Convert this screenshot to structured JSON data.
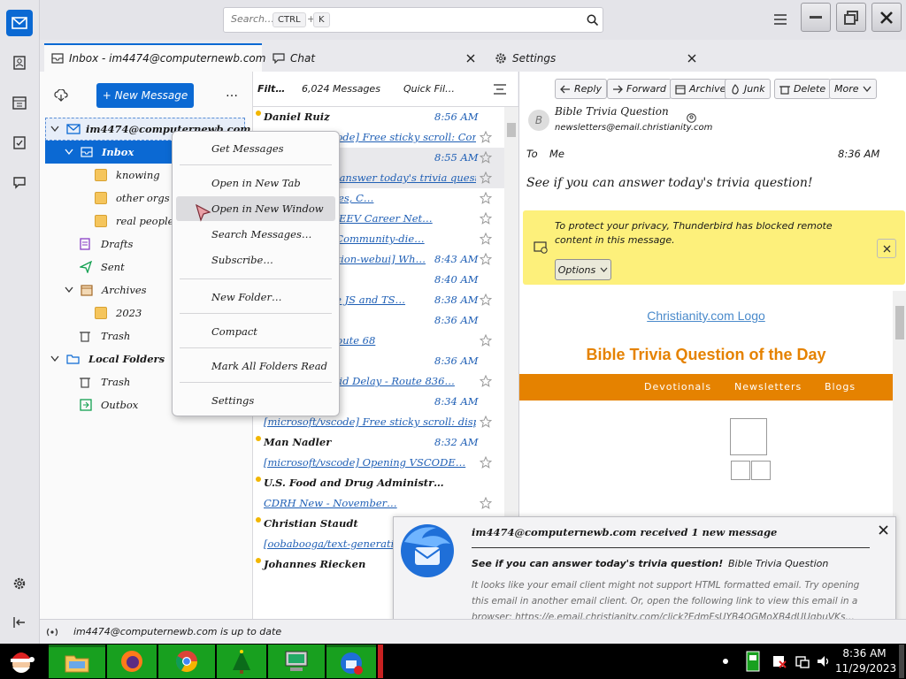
{
  "search": {
    "placeholder": "Search…",
    "key1": "CTRL",
    "key2": "K"
  },
  "tabs": [
    {
      "label": "Inbox - im4474@computernewb.com"
    },
    {
      "label": "Chat"
    },
    {
      "label": "Settings"
    }
  ],
  "folders": {
    "new_message": "+ New Message",
    "more": "…",
    "account": "im4474@computernewb.com",
    "items": [
      {
        "label": "Inbox"
      },
      {
        "label": "knowing"
      },
      {
        "label": "other orgs"
      },
      {
        "label": "real people"
      },
      {
        "label": "Drafts"
      },
      {
        "label": "Sent"
      },
      {
        "label": "Archives"
      },
      {
        "label": "2023"
      },
      {
        "label": "Trash"
      },
      {
        "label": "Local Folders"
      },
      {
        "label": "Trash"
      },
      {
        "label": "Outbox"
      }
    ]
  },
  "list": {
    "header_filter": "Filt…",
    "header_count": "6,024 Messages",
    "header_quick": "Quick Fil…",
    "rows": [
      {
        "sender": "Daniel Ruiz",
        "time": "8:56 AM"
      },
      {
        "subject": "[microsoft/vscode] Free sticky scroll: Compil…"
      },
      {
        "subject": "r",
        "time": "8:55 AM"
      },
      {
        "subject": "See if you can answer today's trivia question!"
      },
      {
        "subject": "Heroku Services, C…"
      },
      {
        "subject": "Apply now for EEV Career Net…"
      },
      {
        "subject": "Join the HHC Community-die…"
      },
      {
        "subject": "…/text-generation-webui] Wh…",
        "time": "8:43 AM"
      },
      {
        "time": "8:40 AM"
      },
      {
        "subject": "…native] Make JS and TS…",
        "time": "8:38 AM"
      },
      {
        "time": "8:36 AM"
      },
      {
        "subject": "…on Detour Route 68"
      },
      {
        "time": "8:36 AM"
      },
      {
        "subject": "CapMetro Rapid Delay - Route 836…"
      },
      {
        "sender": "Daniel Ruiz",
        "time": "8:34 AM"
      },
      {
        "subject": "[microsoft/vscode] Free sticky scroll: display …"
      },
      {
        "sender": "Man Nadler",
        "time": "8:32 AM"
      },
      {
        "subject": "[microsoft/vscode] Opening VSCODE…"
      },
      {
        "sender": "U.S. Food and Drug Administr…"
      },
      {
        "subject": "CDRH New - November…"
      },
      {
        "sender": "Christian Staudt"
      },
      {
        "subject": "[oobabooga/text-generation-we…"
      },
      {
        "sender": "Johannes Riecken"
      }
    ]
  },
  "message": {
    "buttons": [
      "Reply",
      "Forward",
      "Archive",
      "Junk",
      "Delete",
      "More"
    ],
    "subject": "Bible Trivia Question",
    "from": "newsletters@email.christianity.com",
    "to_label": "To",
    "to_value": "Me",
    "time": "8:36 AM",
    "headline": "See if you can answer today's trivia question!",
    "privacy_text": "To protect your privacy, Thunderbird has blocked remote content in this message.",
    "options_label": "Options",
    "logo_text": "Christianity.com Logo",
    "trivia_title": "Bible Trivia Question of the Day",
    "nav": [
      "Devotionals",
      "Newsletters",
      "Blogs"
    ]
  },
  "context_menu": [
    "Get Messages",
    "Open in New Tab",
    "Open in New Window",
    "Search Messages…",
    "Subscribe…",
    "New Folder…",
    "Compact",
    "Mark All Folders Read",
    "Settings"
  ],
  "notification": {
    "title": "im4474@computernewb.com received 1 new message",
    "subject": "See if you can answer today's trivia question!",
    "sender": "Bible Trivia Question",
    "body": "It looks like your email client might not support HTML formatted email. Try opening this email in another email client. Or, open the following link to view this email in a browser: https://e.email.christianity.com/click?EdmFsUYB4QGMoXB4dUUgbuVKs…"
  },
  "status": {
    "text": "im4474@computernewb.com is up to date"
  },
  "taskbar": {
    "time": "8:36 AM",
    "date": "11/29/2023"
  },
  "colors": {
    "accent": "#0b69d3",
    "selection": "#cfe1f7",
    "orange": "#e58200",
    "notice": "#fdf07b"
  }
}
